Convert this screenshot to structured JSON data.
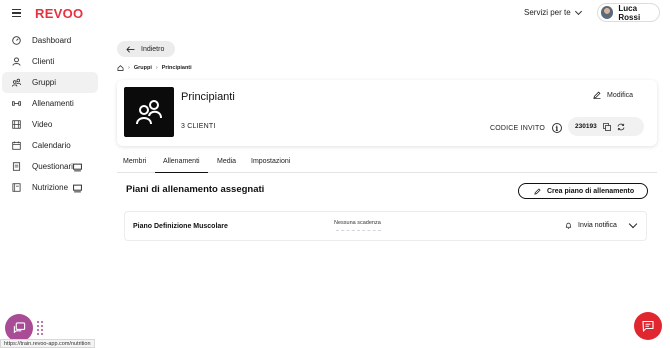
{
  "app": {
    "logo": "REVOO",
    "accent": "#e8313f"
  },
  "topbar": {
    "services_label": "Servizi per te",
    "user_name": "Luca Rossi"
  },
  "sidebar": {
    "items": [
      {
        "label": "Dashboard",
        "icon": "dashboard-icon"
      },
      {
        "label": "Clienti",
        "icon": "user-icon"
      },
      {
        "label": "Gruppi",
        "icon": "group-icon",
        "active": true
      },
      {
        "label": "Allenamenti",
        "icon": "dumbbell-icon"
      },
      {
        "label": "Video",
        "icon": "film-icon"
      },
      {
        "label": "Calendario",
        "icon": "calendar-icon"
      },
      {
        "label": "Questionari",
        "icon": "document-icon",
        "badge": "cast-icon"
      },
      {
        "label": "Nutrizione",
        "icon": "book-icon",
        "badge": "cast-icon"
      }
    ]
  },
  "back_button": {
    "label": "Indietro"
  },
  "breadcrumb": {
    "items": [
      "Gruppi",
      "Principianti"
    ]
  },
  "group_card": {
    "title": "Principianti",
    "clients_count": "3 CLIENTI",
    "edit_label": "Modifica",
    "invite_label": "CODICE INVITO",
    "invite_code": "230193"
  },
  "tabs": [
    {
      "label": "Membri"
    },
    {
      "label": "Allenamenti",
      "active": true
    },
    {
      "label": "Media"
    },
    {
      "label": "Impostazioni"
    }
  ],
  "plans_section": {
    "title": "Piani di allenamento assegnati",
    "create_label": "Crea piano di allenamento",
    "rows": [
      {
        "name": "Piano Definizione Muscolare",
        "deadline": "Nessuna scadenza",
        "notify_label": "Invia notifica"
      }
    ]
  },
  "status_bar": {
    "url": "https://train.revoo-app.com/nutrition"
  }
}
